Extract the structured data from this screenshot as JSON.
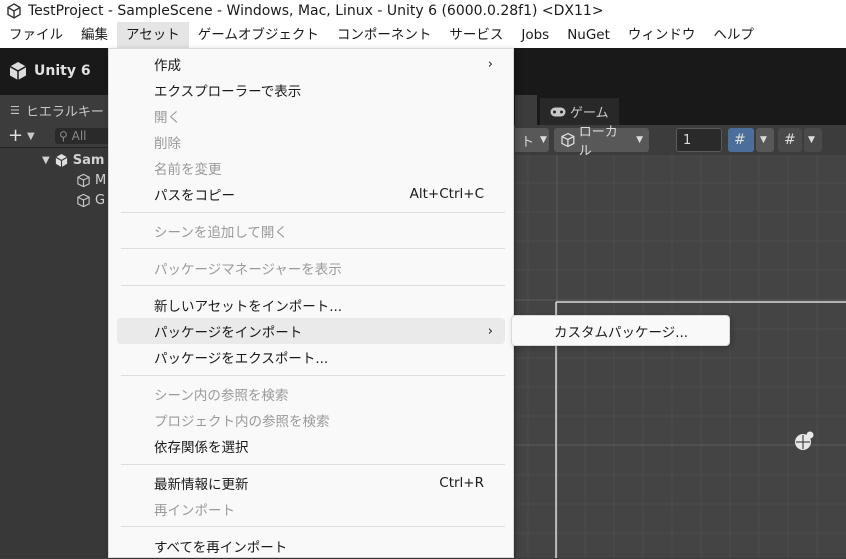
{
  "window": {
    "title": "TestProject - SampleScene - Windows, Mac, Linux - Unity 6 (6000.0.28f1) <DX11>",
    "icon": "unity-logo-icon"
  },
  "menubar": {
    "items": [
      "ファイル",
      "編集",
      "アセット",
      "ゲームオブジェクト",
      "コンポーネント",
      "サービス",
      "Jobs",
      "NuGet",
      "ウィンドウ",
      "ヘルプ"
    ],
    "active_index": 2
  },
  "toolbar": {
    "unity_label": "Unity 6"
  },
  "tabs": {
    "hierarchy": "ヒエラルキー",
    "game": "ゲーム"
  },
  "hierarchy": {
    "search_placeholder": "All",
    "rows": [
      "Sam",
      "M",
      "G"
    ]
  },
  "scene_toolbar": {
    "pivot_fragment": "ト",
    "local_label": "ローカル",
    "snap_value": "1"
  },
  "asset_menu": {
    "items": [
      {
        "label": "作成",
        "shortcut": "",
        "submenu": true,
        "disabled": false
      },
      {
        "label": "エクスプローラーで表示",
        "shortcut": "",
        "submenu": false,
        "disabled": false
      },
      {
        "label": "開く",
        "shortcut": "",
        "submenu": false,
        "disabled": true
      },
      {
        "label": "削除",
        "shortcut": "",
        "submenu": false,
        "disabled": true
      },
      {
        "label": "名前を変更",
        "shortcut": "",
        "submenu": false,
        "disabled": true
      },
      {
        "label": "パスをコピー",
        "shortcut": "Alt+Ctrl+C",
        "submenu": false,
        "disabled": false
      },
      {
        "label": "シーンを追加して開く",
        "shortcut": "",
        "submenu": false,
        "disabled": true
      },
      {
        "label": "パッケージマネージャーを表示",
        "shortcut": "",
        "submenu": false,
        "disabled": true
      },
      {
        "label": "新しいアセットをインポート...",
        "shortcut": "",
        "submenu": false,
        "disabled": false
      },
      {
        "label": "パッケージをインポート",
        "shortcut": "",
        "submenu": true,
        "disabled": false,
        "highlighted": true
      },
      {
        "label": "パッケージをエクスポート...",
        "shortcut": "",
        "submenu": false,
        "disabled": false
      },
      {
        "label": "シーン内の参照を検索",
        "shortcut": "",
        "submenu": false,
        "disabled": true
      },
      {
        "label": "プロジェクト内の参照を検索",
        "shortcut": "",
        "submenu": false,
        "disabled": true
      },
      {
        "label": "依存関係を選択",
        "shortcut": "",
        "submenu": false,
        "disabled": false
      },
      {
        "label": "最新情報に更新",
        "shortcut": "Ctrl+R",
        "submenu": false,
        "disabled": false
      },
      {
        "label": "再インポート",
        "shortcut": "",
        "submenu": false,
        "disabled": true
      },
      {
        "label": "すべてを再インポート",
        "shortcut": "",
        "submenu": false,
        "disabled": false
      }
    ]
  },
  "import_package_submenu": {
    "items": [
      {
        "label": "カスタムパッケージ..."
      }
    ]
  },
  "colors": {
    "menu_bg": "#f9f9f9",
    "disabled_text": "#9a9a9a",
    "editor_dark": "#191919",
    "panel": "#383838",
    "scene_bg": "#444444"
  }
}
